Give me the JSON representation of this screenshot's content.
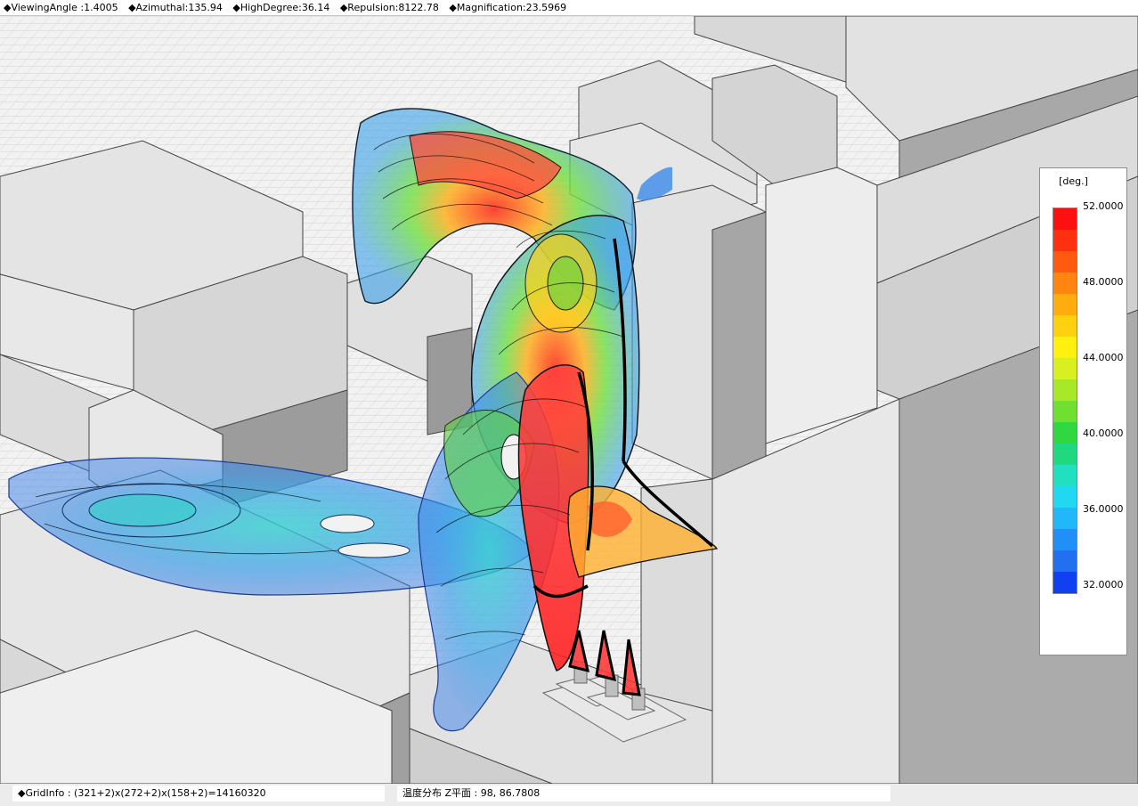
{
  "status_top": {
    "viewing_angle": "◆ViewingAngle :1.4005",
    "azimuthal": "◆Azimuthal:135.94",
    "high_degree": "◆HighDegree:36.14",
    "repulsion": "◆Repulsion:8122.78",
    "magnification": "◆Magnification:23.5969"
  },
  "legend": {
    "unit": "[deg.]",
    "ticks": [
      "52.0000",
      "48.0000",
      "44.0000",
      "40.0000",
      "36.0000",
      "32.0000"
    ],
    "colors": [
      "#ff1010",
      "#ff3010",
      "#ff5a10",
      "#ff8410",
      "#ffac10",
      "#ffd010",
      "#fff010",
      "#d8f020",
      "#a8e828",
      "#70e030",
      "#30d840",
      "#20d880",
      "#20e0c0",
      "#20d8f0",
      "#20b8f8",
      "#2090f8",
      "#2070f0",
      "#1040f0"
    ]
  },
  "status_bottom": {
    "grid_info": "◆GridInfo : (321+2)x(272+2)x(158+2)=14160320",
    "plane_info": "温度分布 Z平面 : 98, 86.7808"
  }
}
